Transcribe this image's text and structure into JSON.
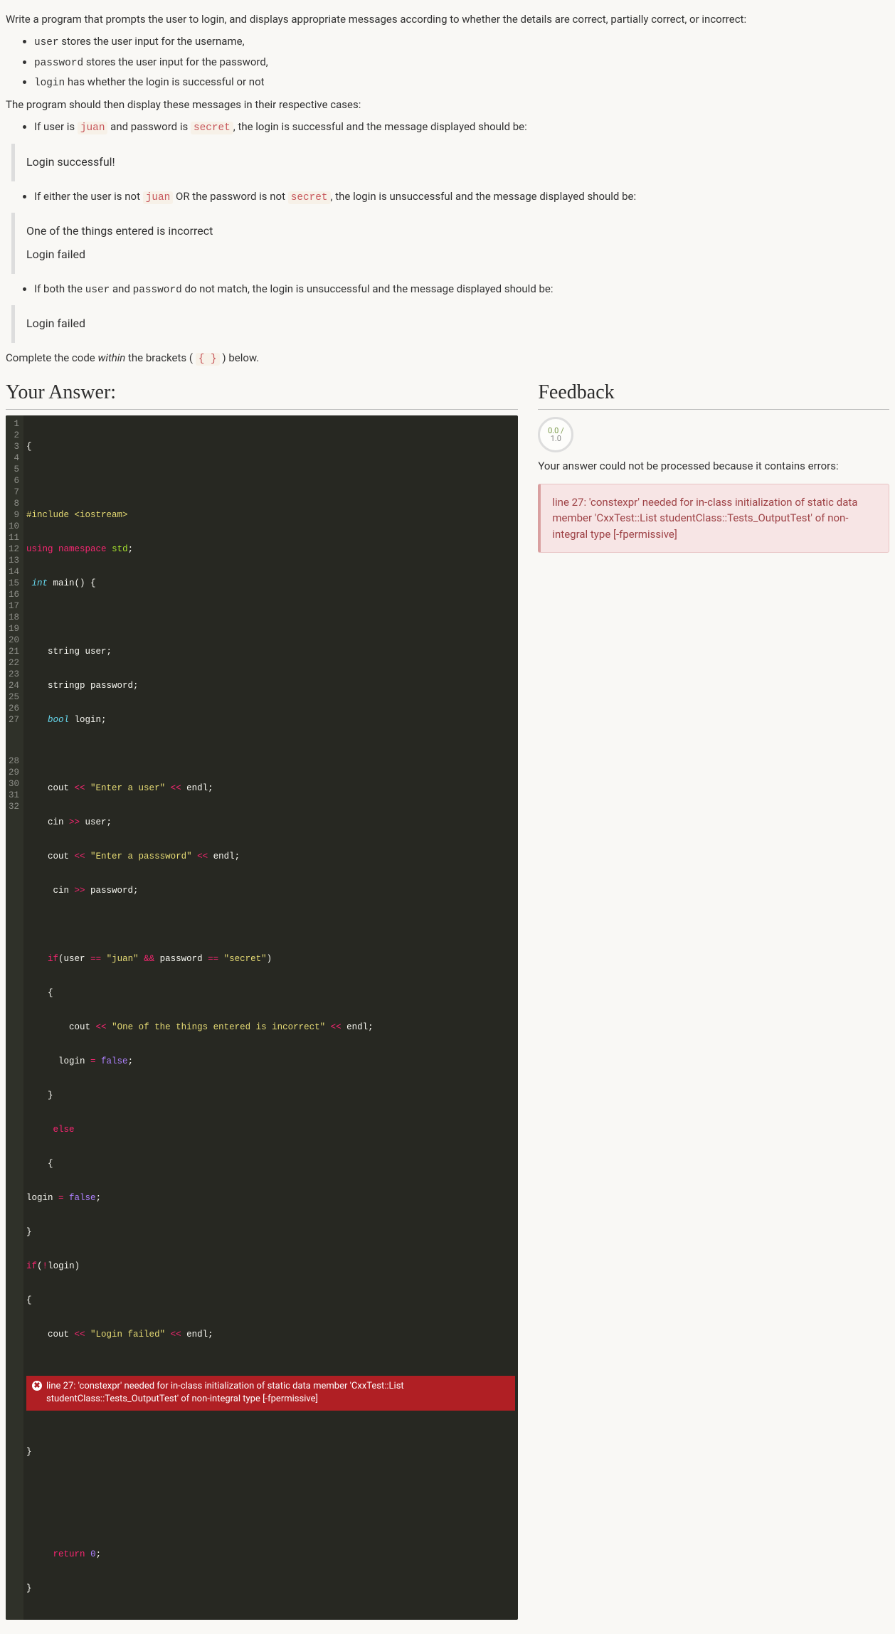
{
  "intro": {
    "prompt_text": "Write a program that prompts the user to login, and displays appropriate messages according to whether the details are correct, partially correct, or incorrect:",
    "vars": [
      {
        "code": "user",
        "desc": " stores the user input for the username,"
      },
      {
        "code": "password",
        "desc": " stores the user input for the password,"
      },
      {
        "code": "login",
        "desc": " has whether the login is successful or not"
      }
    ],
    "cases_intro": "The program should then display these messages in their respective cases:",
    "case1_pre": "If user is ",
    "case1_user": "juan",
    "case1_mid": " and password is ",
    "case1_pass": "secret",
    "case1_post": ", the login is successful and the message displayed should be:",
    "quote1": "Login successful!",
    "case2_pre": "If either the user is not ",
    "case2_user": "juan",
    "case2_mid": " OR the password is not ",
    "case2_pass": "secret",
    "case2_post": ", the login is unsuccessful and the message displayed should be:",
    "quote2a": "One of the things entered is incorrect",
    "quote2b": "Login failed",
    "case3_pre": "If both the ",
    "case3_u": "user",
    "case3_mid": " and ",
    "case3_p": "password",
    "case3_post": " do not match, the login is unsuccessful and the message displayed should be:",
    "quote3": "Login failed",
    "complete_pre": "Complete the code ",
    "complete_within": "within",
    "complete_mid": " the brackets ( ",
    "complete_braces": "{ }",
    "complete_post": " ) below."
  },
  "headings": {
    "answer": "Your Answer:",
    "feedback": "Feedback"
  },
  "editor": {
    "error_msg": "line 27: 'constexpr' needed for in-class initialization of static data member 'CxxTest::List studentClass::Tests_OutputTest' of non-integral type [-fpermissive]"
  },
  "feedback": {
    "score_top": "0.0 /",
    "score_bottom": "1.0",
    "cannot_process": "Your answer could not be processed because it contains errors:",
    "error_detail": "line 27: 'constexpr' needed for in-class initialization of static data member 'CxxTest::List studentClass::Tests_OutputTest' of non-integral type [-fpermissive]"
  },
  "code": {
    "l1": "{",
    "l3": "#include <iostream>",
    "l4_using": "using",
    "l4_ns": "namespace",
    "l4_std": "std",
    "l5_int": " int",
    "l5_main": "main() {",
    "l7": "    string user;",
    "l8": "    stringp password;",
    "l9_bool": "bool",
    "l9_tail": " login;",
    "l11a": "    cout ",
    "l11b": "<<",
    "l11c": " \"Enter a user\" ",
    "l11d": "<<",
    "l11e": " endl;",
    "l12a": "    cin ",
    "l12b": ">>",
    "l12c": " user;",
    "l13a": "    cout ",
    "l13b": "<<",
    "l13c": " \"Enter a passsword\" ",
    "l13d": "<<",
    "l13e": " endl;",
    "l14a": "     cin ",
    "l14b": ">>",
    "l14c": " password;",
    "l16_if": "if",
    "l16a": "(user ",
    "l16b": "==",
    "l16c": " \"juan\" ",
    "l16d": "&&",
    "l16e": " password ",
    "l16f": "==",
    "l16g": " \"secret\"",
    "l16h": ")",
    "l17": "    {",
    "l18a": "        cout ",
    "l18b": "<<",
    "l18c": " \"One of the things entered is incorrect\" ",
    "l18d": "<<",
    "l18e": " endl;",
    "l19a": "      login ",
    "l19b": "=",
    "l19c": " false",
    "l19d": ";",
    "l20": "    }",
    "l21_else": "else",
    "l22": "    {",
    "l23a": "login ",
    "l23b": "=",
    "l23c": " false",
    "l23d": ";",
    "l24": "}",
    "l25_if": "if",
    "l25a": "(",
    "l25b": "!",
    "l25c": "login)",
    "l26": "{",
    "l27a": "    cout ",
    "l27b": "<<",
    "l27c": " \"Login failed\" ",
    "l27d": "<<",
    "l27e": " endl;",
    "l28": "}",
    "l31_ret": "return",
    "l31_zero": "0",
    "l31_sc": ";",
    "l32": "}"
  }
}
